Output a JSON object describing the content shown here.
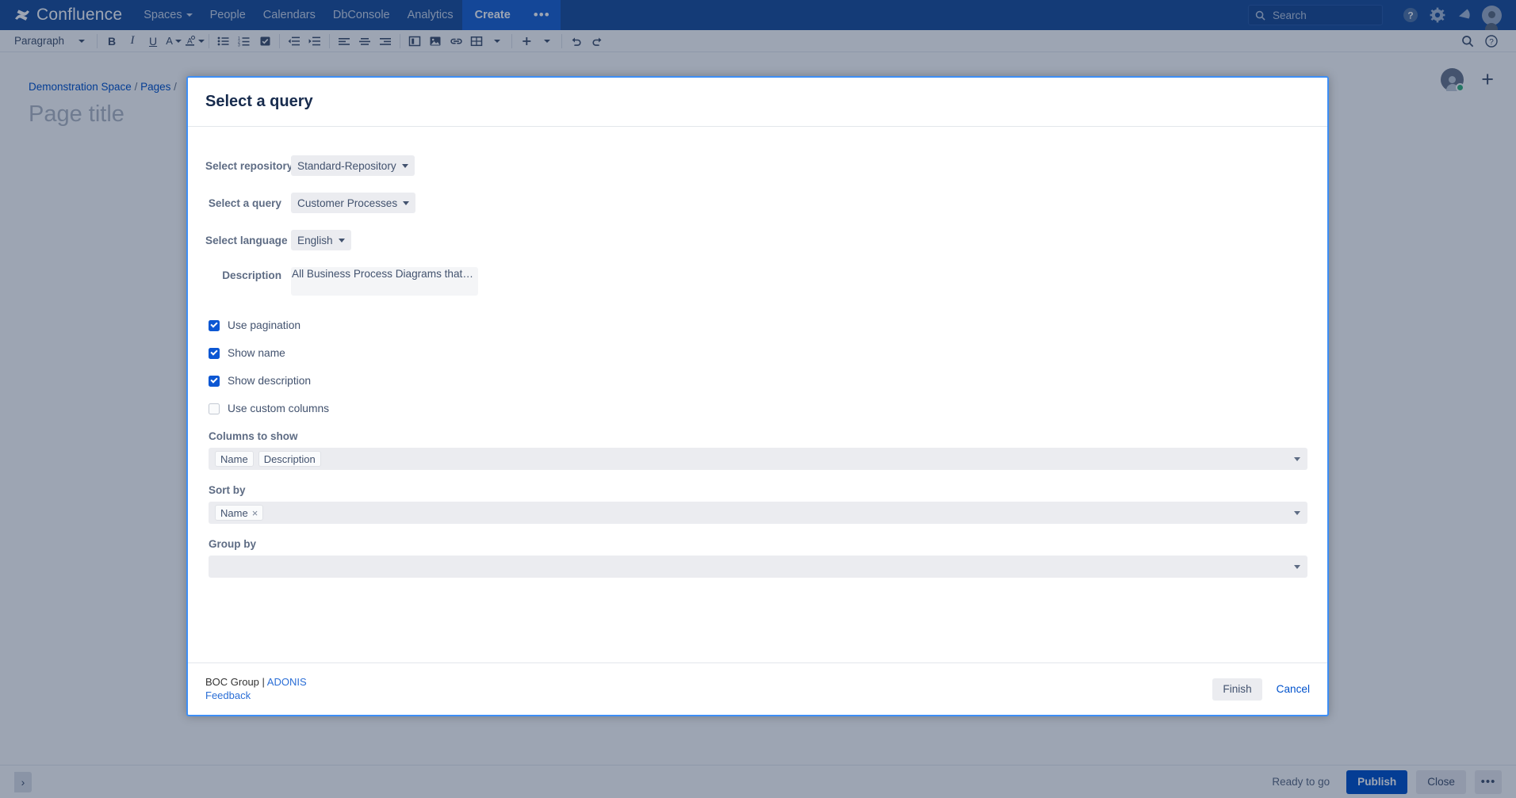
{
  "topnav": {
    "brand": "Confluence",
    "brand_icon": "confluence-logo-icon",
    "links": [
      {
        "label": "Spaces",
        "has_caret": true
      },
      {
        "label": "People",
        "has_caret": false
      },
      {
        "label": "Calendars",
        "has_caret": false
      },
      {
        "label": "DbConsole",
        "has_caret": false
      },
      {
        "label": "Analytics",
        "has_caret": false
      }
    ],
    "create_label": "Create",
    "more_label": "•••",
    "search_placeholder": "Search",
    "icons": [
      "help-icon",
      "gear-icon",
      "notifications-icon",
      "user-avatar-icon"
    ],
    "background": "#1b4f9c"
  },
  "toolbar": {
    "paragraph_label": "Paragraph",
    "buttons": [
      "bold-icon",
      "italic-icon",
      "underline-icon",
      "text-color-icon",
      "text-highlight-icon",
      "bullet-list-icon",
      "numbered-list-icon",
      "task-list-icon",
      "outdent-icon",
      "indent-icon",
      "align-left-icon",
      "align-center-icon",
      "align-right-icon",
      "page-layout-icon",
      "insert-image-icon",
      "insert-link-icon",
      "insert-table-icon",
      "insert-more-icon",
      "undo-icon",
      "redo-icon"
    ],
    "right_buttons": [
      "find-replace-icon",
      "help-icon"
    ]
  },
  "page": {
    "breadcrumb": [
      {
        "label": "Demonstration Space",
        "link": true
      },
      {
        "label": "/",
        "link": false
      },
      {
        "label": "Pages",
        "link": true
      },
      {
        "label": "/",
        "link": false
      }
    ],
    "title_placeholder": "Page title",
    "rail_icons": [
      "page-restrictions-avatar",
      "add-element-icon"
    ]
  },
  "modal": {
    "title": "Select a query",
    "fields": [
      {
        "label": "Select repository",
        "value": "Standard-Repository"
      },
      {
        "label": "Select a query",
        "value": "Customer Processes"
      },
      {
        "label": "Select language",
        "value": "English"
      }
    ],
    "description": {
      "label": "Description",
      "value": "All Business Process Diagrams that…"
    },
    "checkboxes": [
      {
        "label": "Use pagination",
        "checked": true
      },
      {
        "label": "Show name",
        "checked": true
      },
      {
        "label": "Show description",
        "checked": true
      },
      {
        "label": "Use custom columns",
        "checked": false
      }
    ],
    "columns_to_show": {
      "label": "Columns to show",
      "tags": [
        "Name",
        "Description"
      ],
      "removable": false
    },
    "sort_by": {
      "label": "Sort by",
      "tags": [
        "Name"
      ],
      "removable": true,
      "remove_glyph": "×"
    },
    "group_by": {
      "label": "Group by",
      "tags": []
    },
    "footer": {
      "vendor": "BOC Group | ",
      "vendor_link": "ADONIS",
      "feedback_link": "Feedback",
      "finish_label": "Finish",
      "cancel_label": "Cancel"
    },
    "border_color": "#3d8ef5"
  },
  "bottombar": {
    "expand_glyph": "›",
    "status": "Ready to go",
    "publish_label": "Publish",
    "close_label": "Close",
    "more_label": "•••",
    "publish_color": "#0052cc"
  }
}
